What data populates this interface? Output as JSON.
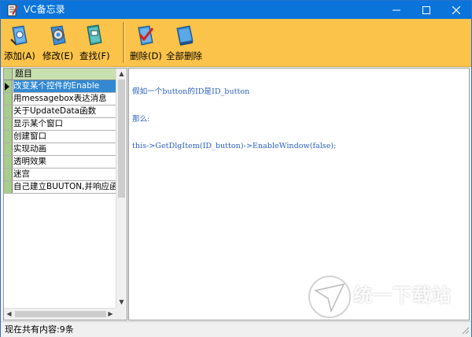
{
  "window": {
    "title": "VC备忘录",
    "minimize_icon": "minimize-icon",
    "maximize_icon": "maximize-icon",
    "close_icon": "close-icon"
  },
  "toolbar": {
    "buttons": [
      {
        "label": "添加(A)",
        "icon": "add-book-icon"
      },
      {
        "label": "修改(E)",
        "icon": "edit-gear-icon"
      },
      {
        "label": "查找(F)",
        "icon": "search-book-icon"
      },
      {
        "label": "删除(D)",
        "icon": "delete-check-icon"
      },
      {
        "label": "全部删除",
        "icon": "delete-all-icon"
      }
    ]
  },
  "list": {
    "header": "题目",
    "items": [
      "改变某个控件的Enable",
      "用messagebox表达消息",
      "关于UpdateData函数",
      "显示某个窗口",
      "创建窗口",
      "实现动画",
      "透明效果",
      "迷宫",
      "自己建立BUUTON,并响应函"
    ],
    "selected_index": 0
  },
  "content": {
    "lines": [
      "假如一个button的ID是ID_button",
      "那么:",
      "this->GetDlgItem(ID_button)->EnableWindow(false);"
    ]
  },
  "status": {
    "text": "现在共有内容:9条"
  },
  "watermark": {
    "title": "统一下载站"
  },
  "colors": {
    "titlebar": "#0a74da",
    "toolbar": "#fbc349",
    "selection": "#3289d2",
    "code_text": "#2a5fc4",
    "row_marker": "#a8cc8c"
  }
}
